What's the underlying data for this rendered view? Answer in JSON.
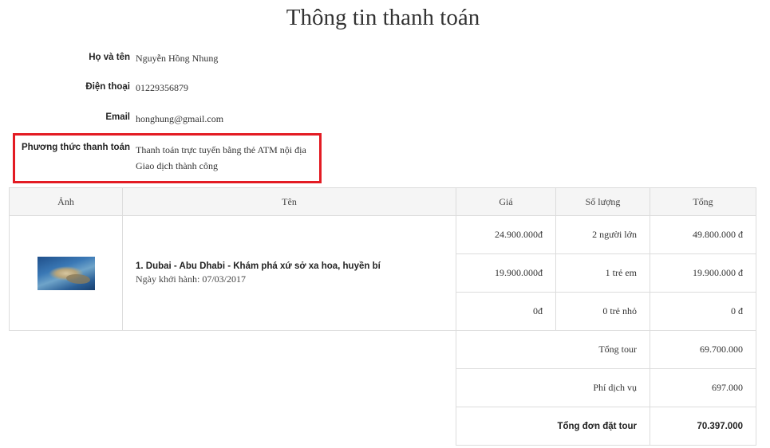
{
  "page_title": "Thông tin thanh toán",
  "customer": {
    "name_label": "Họ và tên",
    "name_value": "Nguyễn Hồng Nhung",
    "phone_label": "Điện thoại",
    "phone_value": "01229356879",
    "email_label": "Email",
    "email_value": "honghung@gmail.com",
    "payment_label": "Phương thức thanh toán",
    "payment_method": "Thanh toán trực tuyến bằng thẻ ATM nội địa",
    "payment_status": "Giao dịch thành công"
  },
  "table": {
    "headers": [
      "Ảnh",
      "Tên",
      "Giá",
      "Số lượng",
      "Tổng"
    ],
    "product_name": "1. Dubai - Abu Dhabi - Khám phá xứ sở xa hoa, huyền bí",
    "departure": "Ngày khởi hành: 07/03/2017",
    "rows": [
      {
        "price": "24.900.000đ",
        "qty": "2 người lớn",
        "total": "49.800.000 đ"
      },
      {
        "price": "19.900.000đ",
        "qty": "1 trẻ em",
        "total": "19.900.000 đ"
      },
      {
        "price": "0đ",
        "qty": "0 trẻ nhỏ",
        "total": "0 đ"
      }
    ],
    "summary": {
      "tour_total_label": "Tổng tour",
      "tour_total_value": "69.700.000",
      "service_fee_label": "Phí dịch vụ",
      "service_fee_value": "697.000",
      "grand_total_label": "Tổng đơn đặt tour",
      "grand_total_value": "70.397.000"
    }
  },
  "colors": {
    "highlight_border": "#e31b23",
    "header_bg": "#f5f5f5",
    "border": "#dcdcdc"
  }
}
